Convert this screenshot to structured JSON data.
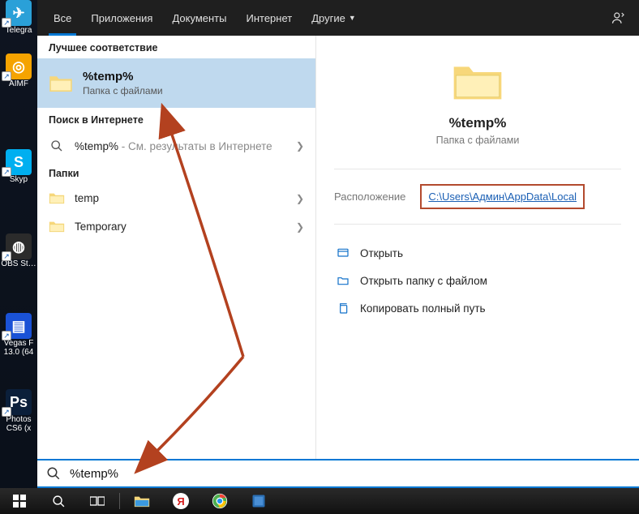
{
  "desktop": {
    "icons": [
      {
        "label": "Telegra",
        "bg": "#2aa0d8",
        "glyph": "✈"
      },
      {
        "label": "AIMF",
        "bg": "#f5a300",
        "glyph": "◎"
      },
      {
        "label": "Skyp",
        "bg": "#00aff0",
        "glyph": "S"
      },
      {
        "label": "OBS St…",
        "bg": "#2b2b2b",
        "glyph": "◍"
      },
      {
        "label": "Vegas F",
        "sub": "13.0 (64",
        "bg": "#1a52d6",
        "glyph": "▤"
      },
      {
        "label": "Photos",
        "sub": "CS6 (x",
        "bg": "#0b1f3a",
        "glyph": "Ps"
      }
    ]
  },
  "tabs": {
    "items": [
      "Все",
      "Приложения",
      "Документы",
      "Интернет",
      "Другие"
    ],
    "active_index": 0
  },
  "results": {
    "best_header": "Лучшее соответствие",
    "best": {
      "title": "%temp%",
      "subtitle": "Папка с файлами"
    },
    "web_header": "Поиск в Интернете",
    "web_item": {
      "query": "%temp%",
      "hint": " - См. результаты в Интернете"
    },
    "folders_header": "Папки",
    "folders": [
      {
        "name": "temp"
      },
      {
        "name": "Temporary"
      }
    ]
  },
  "detail": {
    "title": "%temp%",
    "subtitle": "Папка с файлами",
    "location_label": "Расположение",
    "location_path": "C:\\Users\\Админ\\AppData\\Local",
    "actions": [
      {
        "id": "open",
        "label": "Открыть"
      },
      {
        "id": "open-location",
        "label": "Открыть папку с файлом"
      },
      {
        "id": "copy-path",
        "label": "Копировать полный путь"
      }
    ]
  },
  "search": {
    "value": "%temp%"
  }
}
